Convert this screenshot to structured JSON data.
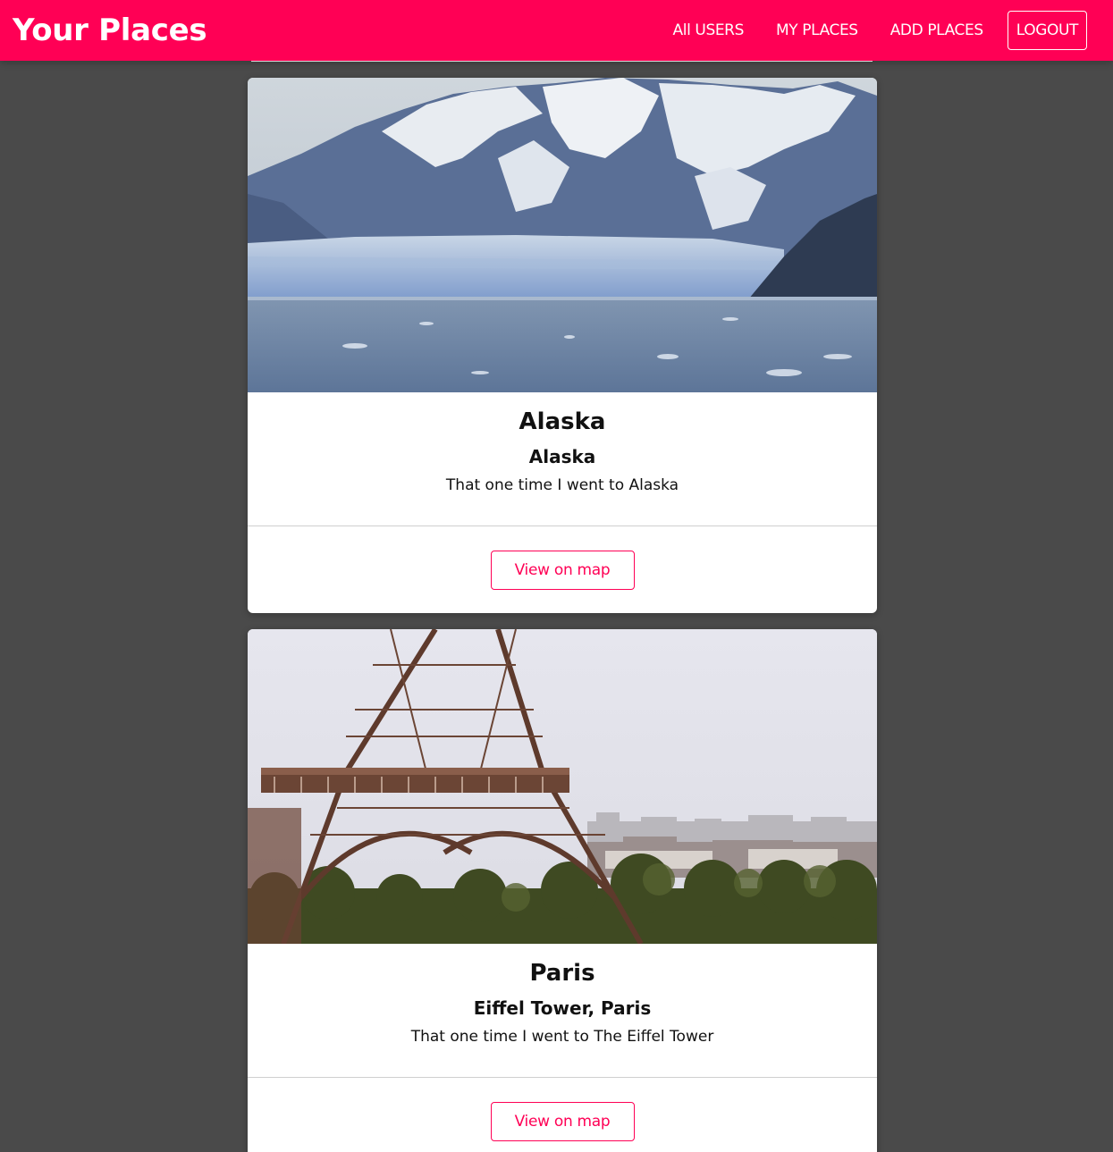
{
  "header": {
    "brand": "Your Places",
    "nav": {
      "all_users": "All USERS",
      "my_places": "MY PLACES",
      "add_places": "ADD PLACES",
      "logout": "LOGOUT"
    }
  },
  "colors": {
    "brand": "#ff0055",
    "background": "#4a4a4a"
  },
  "places": [
    {
      "title": "Alaska",
      "address": "Alaska",
      "description": "That one time I went to Alaska",
      "action": "View on map",
      "image": "glacier-mountain-photo"
    },
    {
      "title": "Paris",
      "address": "Eiffel Tower, Paris",
      "description": "That one time I went to The Eiffel Tower",
      "action": "View on map",
      "image": "eiffel-tower-photo"
    }
  ]
}
